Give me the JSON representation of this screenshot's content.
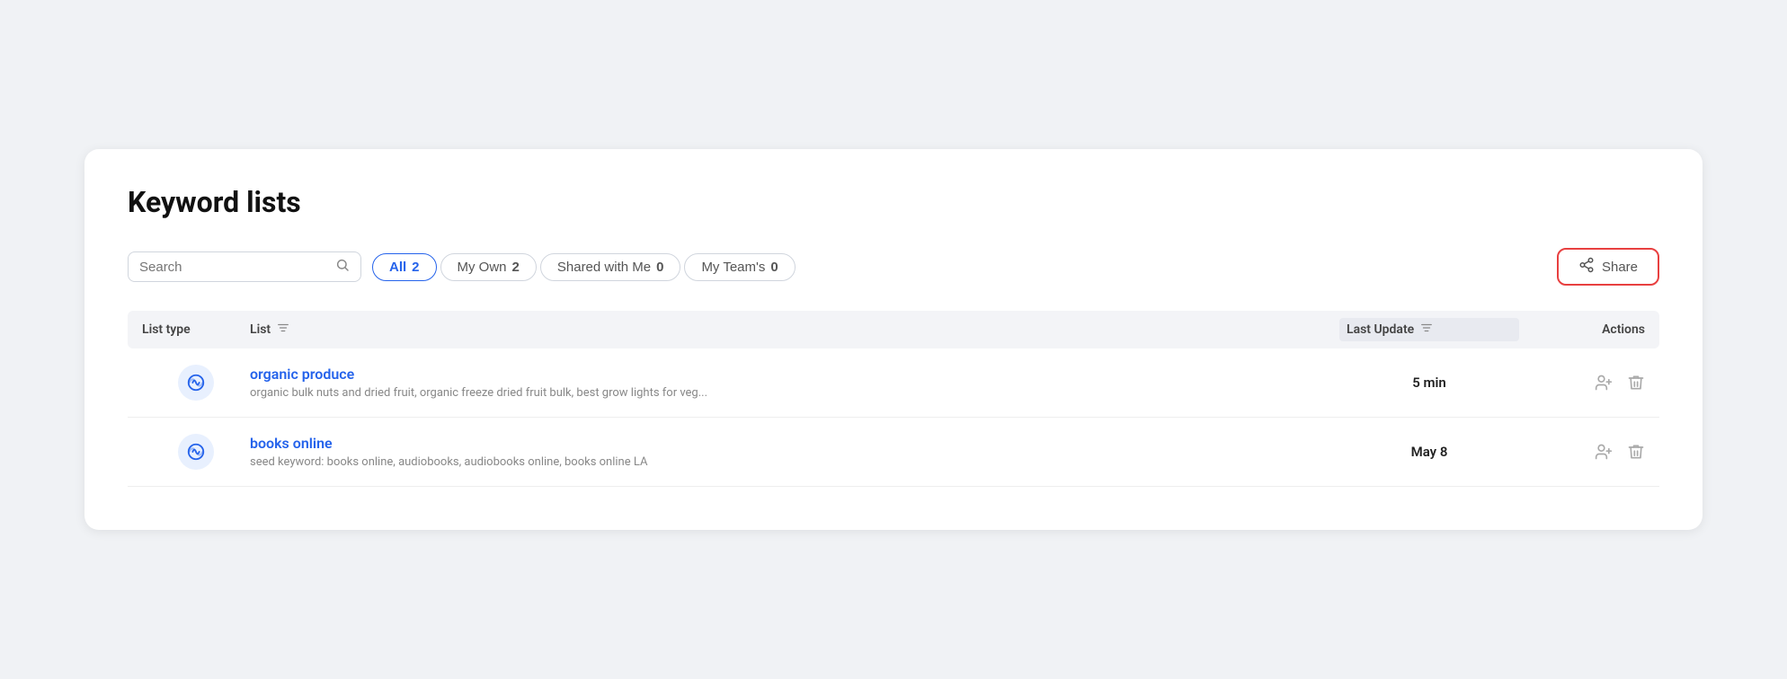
{
  "page": {
    "title": "Keyword lists"
  },
  "search": {
    "placeholder": "Search",
    "value": ""
  },
  "filters": [
    {
      "id": "all",
      "label": "All",
      "count": 2,
      "active": true
    },
    {
      "id": "my-own",
      "label": "My Own",
      "count": 2,
      "active": false
    },
    {
      "id": "shared-with-me",
      "label": "Shared with Me",
      "count": 0,
      "active": false
    },
    {
      "id": "my-teams",
      "label": "My Team's",
      "count": 0,
      "active": false
    }
  ],
  "share_button": {
    "label": "Share"
  },
  "table": {
    "headers": {
      "list_type": "List type",
      "list": "List",
      "last_update": "Last Update",
      "actions": "Actions"
    },
    "rows": [
      {
        "id": "row-1",
        "name": "organic produce",
        "description": "organic bulk nuts and dried fruit, organic freeze dried fruit bulk, best grow lights for veg...",
        "last_update": "5 min"
      },
      {
        "id": "row-2",
        "name": "books online",
        "description": "seed keyword: books online, audiobooks, audiobooks online, books online LA",
        "last_update": "May 8"
      }
    ]
  }
}
